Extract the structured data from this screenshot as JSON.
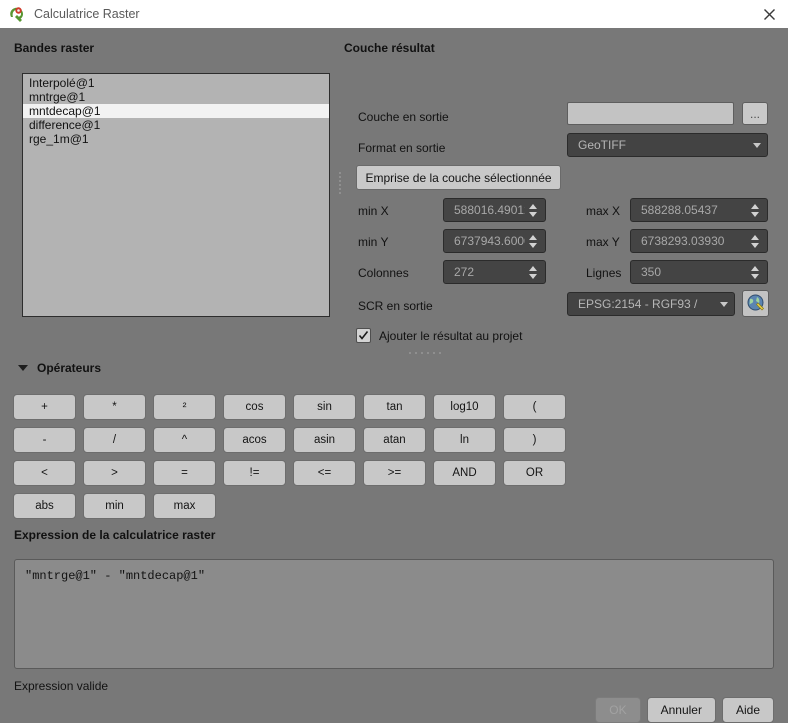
{
  "window": {
    "title": "Calculatrice Raster",
    "app_icon": "qgis-logo-icon",
    "close_icon": "close-icon"
  },
  "bands_panel": {
    "title": "Bandes raster",
    "items": [
      {
        "label": "Interpolé@1",
        "selected": false
      },
      {
        "label": "mntrge@1",
        "selected": false
      },
      {
        "label": "mntdecap@1",
        "selected": true
      },
      {
        "label": "difference@1",
        "selected": false
      },
      {
        "label": "rge_1m@1",
        "selected": false
      }
    ]
  },
  "result_panel": {
    "title": "Couche résultat",
    "output_layer": {
      "label": "Couche en sortie",
      "value": "",
      "placeholder": "",
      "browse_label": "..."
    },
    "output_format": {
      "label": "Format en sortie",
      "value": "GeoTIFF"
    },
    "extent_button": "Emprise de la couche sélectionnée",
    "extent": {
      "min_x": {
        "label": "min X",
        "value": "588016.49012"
      },
      "min_y": {
        "label": "min Y",
        "value": "6737943.60000"
      },
      "max_x": {
        "label": "max X",
        "value": "588288.05437"
      },
      "max_y": {
        "label": "max Y",
        "value": "6738293.03930"
      },
      "columns": {
        "label": "Colonnes",
        "value": "272"
      },
      "rows": {
        "label": "Lignes",
        "value": "350"
      }
    },
    "crs": {
      "label": "SCR en sortie",
      "value": "EPSG:2154 - RGF93 /",
      "select_icon": "crs-globe-icon"
    },
    "add_to_project": {
      "label": "Ajouter le résultat au projet",
      "checked": true
    }
  },
  "operators": {
    "title": "Opérateurs",
    "expanded": true,
    "rows": [
      [
        "+",
        "*",
        "²",
        "cos",
        "sin",
        "tan",
        "log10",
        "("
      ],
      [
        "-",
        "/",
        "^",
        "acos",
        "asin",
        "atan",
        "ln",
        ")"
      ],
      [
        "<",
        ">",
        "=",
        "!=",
        "<=",
        ">=",
        "AND",
        "OR"
      ],
      [
        "abs",
        "min",
        "max"
      ]
    ]
  },
  "expression": {
    "title": "Expression de la calculatrice raster",
    "value": "\"mntrge@1\" - \"mntdecap@1\"",
    "status": "Expression valide"
  },
  "buttons": {
    "ok": "OK",
    "ok_enabled": false,
    "cancel": "Annuler",
    "help": "Aide"
  }
}
